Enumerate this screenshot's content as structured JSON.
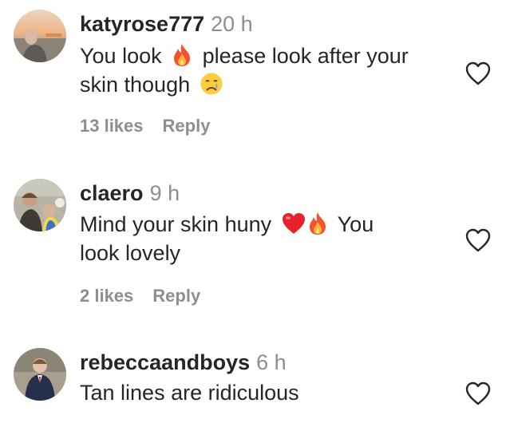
{
  "comments": [
    {
      "username": "katyrose777",
      "time": "20 h",
      "text_before": "You look",
      "emoji1": "fire-emoji",
      "text_after": "please look after your",
      "text_line2": "skin though",
      "emoji2": "crying-face-emoji",
      "likes": "13 likes",
      "reply": "Reply"
    },
    {
      "username": "claero",
      "time": "9 h",
      "text_before": "Mind your skin huny",
      "emoji1": "red-heart-emoji",
      "emoji2": "fire-emoji",
      "text_after": "You",
      "text_line2": "look lovely",
      "likes": "2 likes",
      "reply": "Reply"
    },
    {
      "username": "rebeccaandboys",
      "time": "6 h",
      "text": "Tan lines are ridiculous"
    }
  ],
  "colors": {
    "text": "#262626",
    "secondary": "#8e8e8e"
  },
  "icons": {
    "like": "heart-outline-icon"
  }
}
